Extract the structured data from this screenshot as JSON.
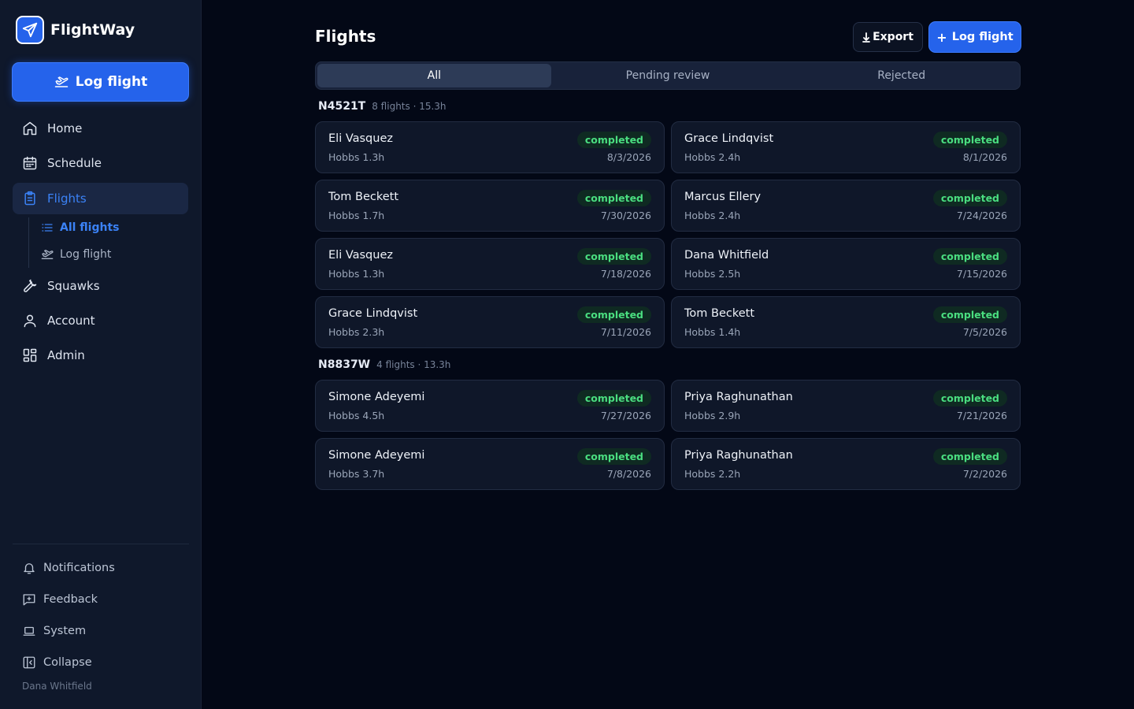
{
  "app": {
    "name": "FlightWay"
  },
  "sidebar": {
    "log_button": "Log flight",
    "nav": [
      {
        "label": "Home",
        "icon": "home-icon"
      },
      {
        "label": "Schedule",
        "icon": "calendar-icon"
      },
      {
        "label": "Flights",
        "icon": "clipboard-icon",
        "active": true
      },
      {
        "label": "Squawks",
        "icon": "wrench-icon"
      },
      {
        "label": "Account",
        "icon": "user-icon"
      },
      {
        "label": "Admin",
        "icon": "grid-icon"
      }
    ],
    "sub_nav": [
      {
        "label": "All flights",
        "icon": "list-icon",
        "active": true
      },
      {
        "label": "Log flight",
        "icon": "plane-takeoff-icon"
      }
    ],
    "footer": [
      {
        "label": "Notifications",
        "icon": "bell-icon"
      },
      {
        "label": "Feedback",
        "icon": "message-plus-icon"
      },
      {
        "label": "System",
        "icon": "laptop-icon"
      },
      {
        "label": "Collapse",
        "icon": "collapse-panel-icon"
      }
    ],
    "user": "Dana Whitfield"
  },
  "header": {
    "title": "Flights",
    "export_label": "Export",
    "log_label": "Log flight"
  },
  "tabs": [
    {
      "label": "All",
      "active": true
    },
    {
      "label": "Pending review"
    },
    {
      "label": "Rejected"
    }
  ],
  "groups": [
    {
      "tail": "N4521T",
      "meta": "8 flights · 15.3h",
      "flights": [
        {
          "pilot": "Eli Vasquez",
          "hobbs": "Hobbs 1.3h",
          "status": "completed",
          "date": "8/3/2026"
        },
        {
          "pilot": "Grace Lindqvist",
          "hobbs": "Hobbs 2.4h",
          "status": "completed",
          "date": "8/1/2026"
        },
        {
          "pilot": "Tom Beckett",
          "hobbs": "Hobbs 1.7h",
          "status": "completed",
          "date": "7/30/2026"
        },
        {
          "pilot": "Marcus Ellery",
          "hobbs": "Hobbs 2.4h",
          "status": "completed",
          "date": "7/24/2026"
        },
        {
          "pilot": "Eli Vasquez",
          "hobbs": "Hobbs 1.3h",
          "status": "completed",
          "date": "7/18/2026"
        },
        {
          "pilot": "Dana Whitfield",
          "hobbs": "Hobbs 2.5h",
          "status": "completed",
          "date": "7/15/2026"
        },
        {
          "pilot": "Grace Lindqvist",
          "hobbs": "Hobbs 2.3h",
          "status": "completed",
          "date": "7/11/2026"
        },
        {
          "pilot": "Tom Beckett",
          "hobbs": "Hobbs 1.4h",
          "status": "completed",
          "date": "7/5/2026"
        }
      ]
    },
    {
      "tail": "N8837W",
      "meta": "4 flights · 13.3h",
      "flights": [
        {
          "pilot": "Simone Adeyemi",
          "hobbs": "Hobbs 4.5h",
          "status": "completed",
          "date": "7/27/2026"
        },
        {
          "pilot": "Priya Raghunathan",
          "hobbs": "Hobbs 2.9h",
          "status": "completed",
          "date": "7/21/2026"
        },
        {
          "pilot": "Simone Adeyemi",
          "hobbs": "Hobbs 3.7h",
          "status": "completed",
          "date": "7/8/2026"
        },
        {
          "pilot": "Priya Raghunathan",
          "hobbs": "Hobbs 2.2h",
          "status": "completed",
          "date": "7/2/2026"
        }
      ]
    }
  ],
  "colors": {
    "accent": "#2563eb",
    "status_completed": "#4ade80",
    "background": "#030816",
    "sidebar": "#0f182b"
  }
}
